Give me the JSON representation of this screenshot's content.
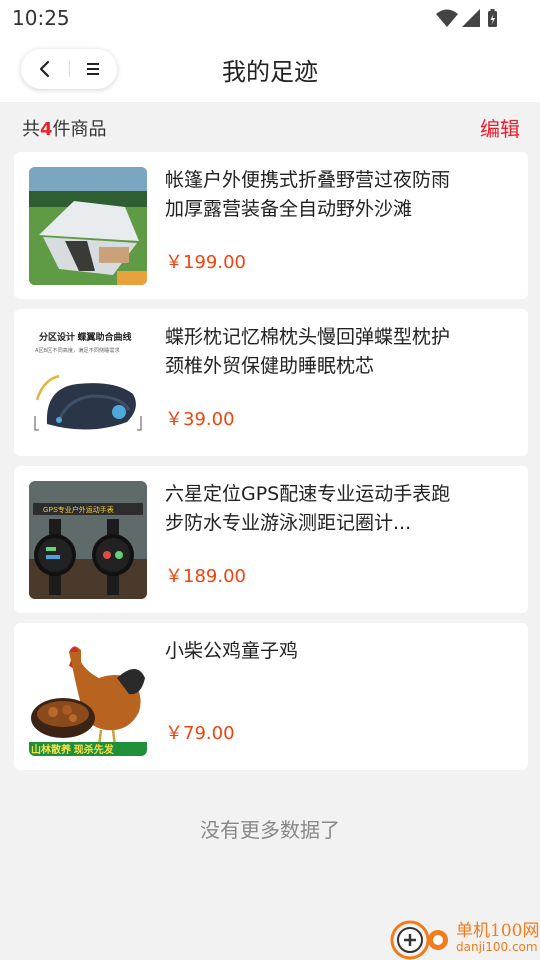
{
  "status_bar": {
    "time": "10:25"
  },
  "header": {
    "title": "我的足迹"
  },
  "summary": {
    "prefix": "共",
    "count": "4",
    "suffix": "件商品",
    "edit_label": "编辑"
  },
  "items": [
    {
      "title": "帐篷户外便携式折叠野营过夜防雨加厚露营装备全自动野外沙滩",
      "price": "￥199.00"
    },
    {
      "title": "蝶形枕记忆棉枕头慢回弹蝶型枕护颈椎外贸保健助睡眠枕芯",
      "price": "￥39.00",
      "image_text_1": "分区设计 蝶翼助合曲线",
      "image_text_2": "A区B区不同高度，满足不同侧睡需求"
    },
    {
      "title": "六星定位GPS配速专业运动手表跑步防水专业游泳测距记圈计...",
      "price": "￥189.00",
      "image_text_1": "GPS专业户外运动手表"
    },
    {
      "title": "小柴公鸡童子鸡",
      "price": "￥79.00",
      "image_text_1": "山林散养 现杀先发"
    }
  ],
  "footer": {
    "no_more": "没有更多数据了"
  },
  "watermark": {
    "line1": "单机100网",
    "line2": "danji100.com"
  },
  "colors": {
    "accent": "#e8212d",
    "price": "#f0440e",
    "watermark": "#f07c1b"
  }
}
